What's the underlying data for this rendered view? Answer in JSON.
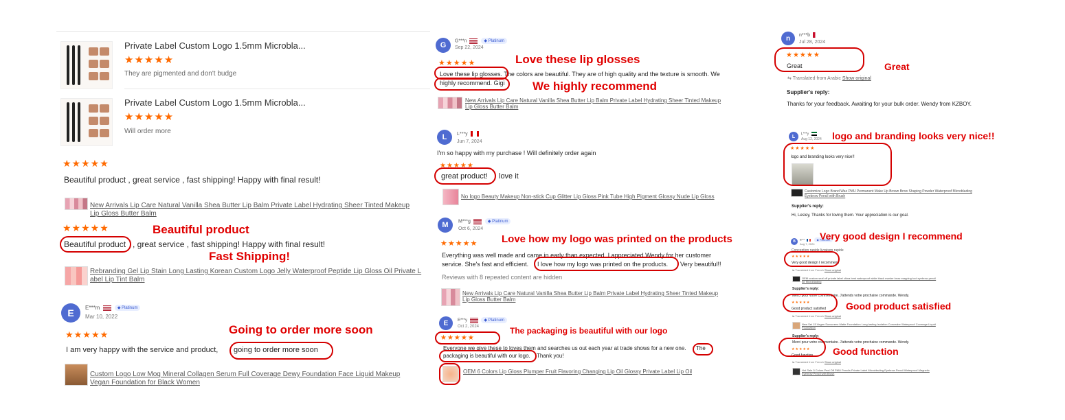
{
  "left": {
    "products": [
      {
        "title": "Private Label Custom Logo 1.5mm Microbla...",
        "stars": "★★★★★",
        "text": "They are pigmented and don't budge"
      },
      {
        "title": "Private Label Custom Logo 1.5mm Microbla...",
        "stars": "★★★★★",
        "text": "Will order more"
      }
    ],
    "review1": {
      "stars": "★★★★★",
      "text": "Beautiful product , great service , fast shipping! Happy with final result!",
      "link_line1": "New Arrivals Lip Care Natural Vanilla Shea Butter Lip Balm Private Label Hydrating Sheer Tinted Makeup",
      "link_line2": "Lip Gloss Butter Balm"
    },
    "review2": {
      "stars": "★★★★★",
      "highlight": "Beautiful product",
      "rest": ", great service , fast shipping! Happy with final result!",
      "link_line1": "Rebranding Gel Lip Stain Long Lasting Korean Custom Logo Jelly Waterproof Peptide Lip Gloss Oil Private L",
      "link_line2": "abel Lip Tint Balm"
    },
    "review3": {
      "avatar": "E",
      "name": "E***m",
      "badge": "Platinum",
      "date": "Mar 10, 2022",
      "stars": "★★★★★",
      "text": "I am very happy with the service and product,",
      "highlight": "going to order more soon",
      "link_line1": "Custom Logo Low Moq Mineral Collagen Serum Full Coverage Dewy Foundation Face Liquid Makeup",
      "link_line2": "Vegan Foundation for Black Women"
    },
    "annotations": {
      "beautiful": "Beautiful product",
      "fast": "Fast Shipping!",
      "order": "Going to order more soon"
    }
  },
  "middle": {
    "r1": {
      "avatar": "G",
      "name": "G***n",
      "badge": "Platinum",
      "date": "Sep 22, 2024",
      "stars": "★★★★★",
      "line1": "Love these lip glosses. The colors are beautiful. They are of high quality and the texture is smooth. We",
      "line2": "highly recommend. Gigi",
      "link_line1": "New Arrivals Lip Care Natural Vanilla Shea Butter Lip Balm Private Label Hydrating Sheer Tinted Makeup",
      "link_line2": "Lip Gloss Butter Balm",
      "ann1": "Love these lip glosses",
      "ann2": "We highly recommend"
    },
    "r2": {
      "avatar": "L",
      "name": "L***y",
      "date": "Jun 7, 2024",
      "text": "I'm so happy with my purchase ! Will definitely order again",
      "stars": "★★★★★",
      "highlight": "great product!",
      "rest": "love it",
      "link": "No logo Beauty Makeup Non-stick Cup Glitter Lip Gloss Pink Tube High Pigment Glossy Nude Lip Gloss"
    },
    "r3": {
      "avatar": "M",
      "name": "M***g",
      "badge": "Platinum",
      "date": "Oct 6, 2024",
      "stars": "★★★★★",
      "line1": "Everything was well made and came in early than expected. I appreciated Wendy for her customer",
      "line2a": "service. She's fast and efficient.",
      "line2b": "I love how my logo was printed on the products.",
      "line2c": "Very beautiful!!",
      "repeated": "Reviews with 8 repeated content are hidden",
      "link_line1": "New Arrivals Lip Care Natural Vanilla Shea Butter Lip Balm Private Label Hydrating Sheer Tinted Makeup",
      "link_line2": "Lip Gloss Butter Balm",
      "ann": "Love how my logo was printed on the products"
    },
    "r4": {
      "avatar": "E",
      "name": "E***y",
      "badge": "Platinum",
      "date": "Oct 2, 2024",
      "stars": "★★★★★",
      "line1": "Everyone we give these to loves them and searches us out each year at trade shows for a new one.",
      "line1b": "The",
      "line2a": "packaging is beautiful with our logo.",
      "line2b": "Thank you!",
      "link": "OEM 6 Colors Lip Gloss Plumper Fruit Flavoring Changing Lip Oil Glossy Private Label Lip Oil",
      "ann": "The packaging is beautiful with our logo"
    }
  },
  "right": {
    "r1": {
      "avatar": "n",
      "name": "n***b",
      "date": "Jul 28, 2024",
      "stars": "★★★★★",
      "text": "Great",
      "translated": "Translated from Arabic",
      "show_original": "Show original",
      "reply_label": "Supplier's reply:",
      "reply": "Thanks for your feedback. Awaiting for your bulk order. Wendy from KZBOY.",
      "ann": "Great"
    },
    "r2": {
      "avatar": "L",
      "name": "L***y",
      "date": "Aug 12, 2024",
      "stars": "★★★★★",
      "text": "logo and branding looks very nice!!",
      "link_line1": "Customize Logo Brand Wax PMU Permanent Make Up Brown Brow Shaping Powder Waterproof Microblading",
      "link_line2": "Eyebrow Pencil with Brush",
      "reply_label": "Supplier's reply:",
      "reply": "Hi, Lesley, Thanks for loving them. Your appreciation is our goal.",
      "ann": "logo and branding looks very nice!!"
    },
    "r3": {
      "avatar": "B",
      "name": "B***",
      "date": "Aug 7, 2024",
      "badge": "Platinum",
      "text0": "Conception rapide livraison rapide",
      "stars": "★★★★★",
      "text": "Very good design I recommend",
      "translated": "Translated from French",
      "show_original": "Show original",
      "link_line1": "OEM custom seal off private label china best waterproof white black marker brow mapping tool eyebrow pencil",
      "link_line2": "for Microblading",
      "reply_label": "Supplier's reply:",
      "reply": "Merci pour votre commentaire. J'attends votre prochaine commande. Wendy.",
      "ann": "Very good design I recommend"
    },
    "r4": {
      "stars": "★★★★★",
      "text": "Good product satisfied",
      "translated": "Translated from French",
      "show_original": "Show original",
      "link_line1": "New Set 15 Vegan Sunscreen Matte Foundation Long-lasting Isolation Concealer Waterproof Coverage Liquid",
      "link_line2": "Foundation",
      "reply_label": "Supplier's reply:",
      "reply": "Merci pour votre commentaire. J'attends votre prochaine commande. Wendy.",
      "ann": "Good product satisfied"
    },
    "r5": {
      "stars": "★★★★★",
      "text": "Good function",
      "translated": "Translated from French",
      "show_original": "Show original",
      "link_line1": "Hot Sale 5 Colors Peel Off PMU Pencils Private Label Microblading Eyebrow Pencil Waterproof Magnetic",
      "link_line2": "Eyebrow Pencil with Brush",
      "ann": "Good function"
    }
  },
  "colors": {
    "star": "#ff6a00",
    "annotation": "#e00000",
    "avatar": "#4f6bd1"
  }
}
